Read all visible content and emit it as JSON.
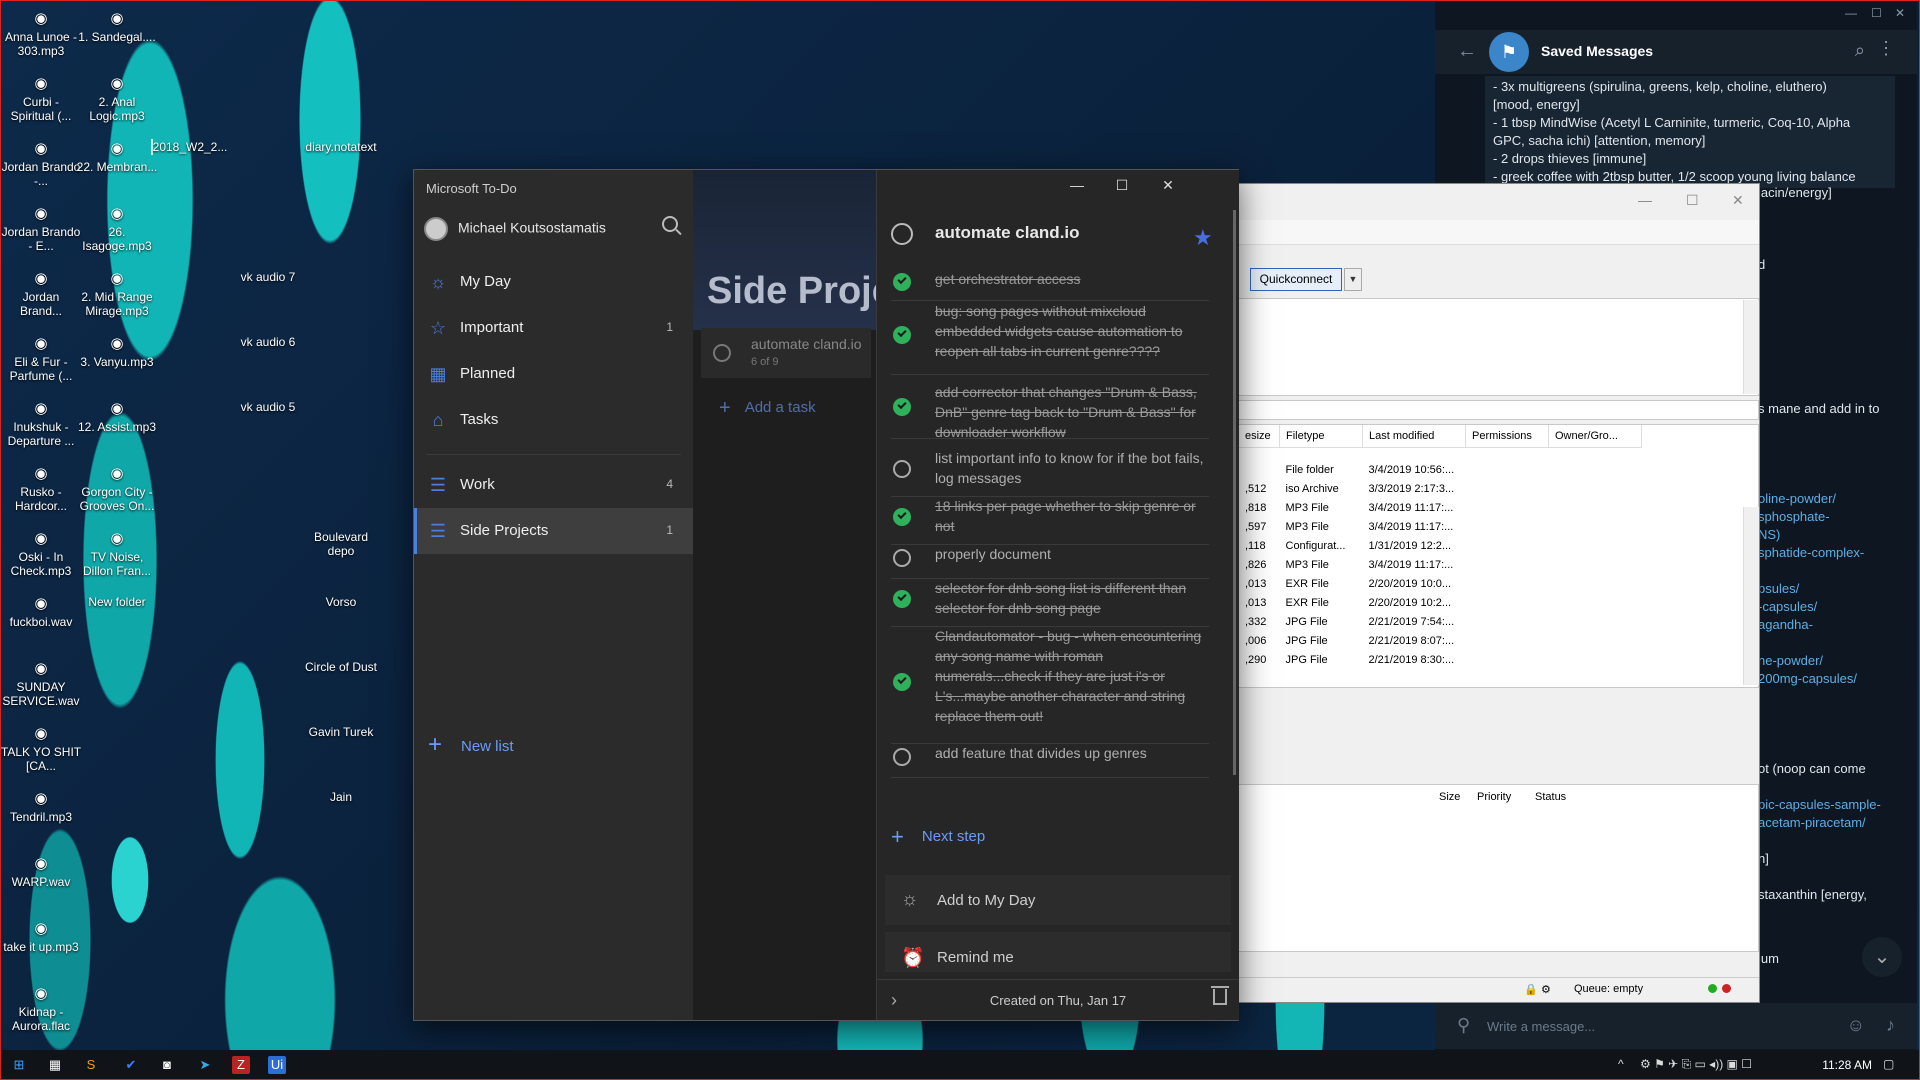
{
  "desktop": {
    "icons": [
      {
        "label": "Anna Lunoe - 303.mp3",
        "type": "audio"
      },
      {
        "label": "1. Sandegal....",
        "type": "audio"
      },
      {
        "label": "Curbi - Spiritual (...",
        "type": "audio"
      },
      {
        "label": "2. Anal Logic.mp3",
        "type": "audio"
      },
      {
        "label": "Jordan Brando -...",
        "type": "audio"
      },
      {
        "label": "22. Membran...",
        "type": "audio"
      },
      {
        "label": "2018_W2_2...",
        "type": "image"
      },
      {
        "label": "diary.notatext",
        "type": "file"
      },
      {
        "label": "Jordan Brando - E...",
        "type": "audio"
      },
      {
        "label": "26. Isagoge.mp3",
        "type": "audio"
      },
      {
        "label": "Jordan Brand...",
        "type": "audio"
      },
      {
        "label": "2. Mid Range Mirage.mp3",
        "type": "audio"
      },
      {
        "label": "vk audio 7",
        "type": "folder"
      },
      {
        "label": "Eli & Fur - Parfume (...",
        "type": "audio"
      },
      {
        "label": "3. Vanyu.mp3",
        "type": "audio"
      },
      {
        "label": "vk audio 6",
        "type": "folder"
      },
      {
        "label": "Inukshuk - Departure ...",
        "type": "audio"
      },
      {
        "label": "12. Assist.mp3",
        "type": "audio"
      },
      {
        "label": "vk audio 5",
        "type": "folder"
      },
      {
        "label": "Rusko - Hardcor...",
        "type": "audio"
      },
      {
        "label": "Gorgon City - Grooves On...",
        "type": "audio"
      },
      {
        "label": "Oski - In Check.mp3",
        "type": "audio"
      },
      {
        "label": "TV Noise, Dillon Fran...",
        "type": "audio"
      },
      {
        "label": "Boulevard depo",
        "type": "folder"
      },
      {
        "label": "fuckboi.wav",
        "type": "audio"
      },
      {
        "label": "New folder",
        "type": "folder"
      },
      {
        "label": "Vorso",
        "type": "folder"
      },
      {
        "label": "SUNDAY SERVICE.wav",
        "type": "audio"
      },
      {
        "label": "Circle of Dust",
        "type": "folder"
      },
      {
        "label": "TALK YO SHIT [CA...",
        "type": "audio"
      },
      {
        "label": "Gavin Turek",
        "type": "folder"
      },
      {
        "label": "Tendril.mp3",
        "type": "audio"
      },
      {
        "label": "Jain",
        "type": "folder"
      },
      {
        "label": "WARP.wav",
        "type": "audio"
      },
      {
        "label": "take it up.mp3",
        "type": "audio"
      },
      {
        "label": "Kidnap - Aurora.flac",
        "type": "audio"
      }
    ]
  },
  "todo": {
    "app_title": "Microsoft To-Do",
    "user_name": "Michael Koutsostamatis",
    "nav": [
      {
        "label": "My Day",
        "count": "",
        "icon": "sun-icon"
      },
      {
        "label": "Important",
        "count": "1",
        "icon": "star-icon"
      },
      {
        "label": "Planned",
        "count": "",
        "icon": "calendar-icon"
      },
      {
        "label": "Tasks",
        "count": "",
        "icon": "home-icon"
      }
    ],
    "lists": [
      {
        "label": "Work",
        "count": "4",
        "icon": "list-icon"
      },
      {
        "label": "Side Projects",
        "count": "1",
        "icon": "list-icon"
      }
    ],
    "new_list": "New list",
    "middle": {
      "title": "Side Proje",
      "task_title": "automate cland.io",
      "task_sub": "6 of 9",
      "add_task": "Add a task"
    },
    "detail": {
      "title": "automate cland.io",
      "steps": [
        {
          "text": "get orchestrator access",
          "done": true
        },
        {
          "text": "bug: song pages without mixcloud embedded widgets cause automation to reopen all tabs in current genre????",
          "done": true
        },
        {
          "text": "add corrector that changes \"Drum & Bass, DnB\" genre tag back to \"Drum & Bass\" for downloader workflow",
          "done": true
        },
        {
          "text": "list important info to know for if the bot fails, log messages",
          "done": false
        },
        {
          "text": "18 links per page whether to skip genre or not",
          "done": true
        },
        {
          "text": "properly document",
          "done": false
        },
        {
          "text": "selector for dnb song list is different than selector for dnb song page",
          "done": true
        },
        {
          "text": "Clandautomator - bug - when encountering any song name with roman numerals...check if they are just i's or L's...maybe another character and string replace them out!",
          "done": true
        },
        {
          "text": "add feature that divides up genres",
          "done": false
        }
      ],
      "next_step": "Next step",
      "add_to_my_day": "Add to My Day",
      "remind_me": "Remind me",
      "created": "Created on Thu, Jan 17"
    }
  },
  "filezilla": {
    "quickconnect": "Quickconnect",
    "columns": [
      "esize",
      "Filetype",
      "Last modified",
      "Permissions",
      "Owner/Gro..."
    ],
    "rows": [
      [
        "",
        "File folder",
        "3/4/2019 10:56:..."
      ],
      [
        ",512",
        "iso Archive",
        "3/3/2019 2:17:3..."
      ],
      [
        ",818",
        "MP3 File",
        "3/4/2019 11:17:..."
      ],
      [
        ",597",
        "MP3 File",
        "3/4/2019 11:17:..."
      ],
      [
        ",118",
        "Configurat...",
        "1/31/2019 12:2..."
      ],
      [
        ",826",
        "MP3 File",
        "3/4/2019 11:17:..."
      ],
      [
        ",013",
        "EXR File",
        "2/20/2019 10:0..."
      ],
      [
        ",013",
        "EXR File",
        "2/20/2019 10:2..."
      ],
      [
        ",332",
        "JPG File",
        "2/21/2019 7:54:..."
      ],
      [
        ",006",
        "JPG File",
        "2/21/2019 8:07:..."
      ],
      [
        ",290",
        "JPG File",
        "2/21/2019 8:30:..."
      ]
    ],
    "queue_columns": [
      "Size",
      "Priority",
      "Status"
    ],
    "queue_status": "Queue: empty"
  },
  "telegram": {
    "title": "Saved Messages",
    "message_lines": [
      "- 3x multigreens (spirulina, greens, kelp, choline, eluthero)",
      "[mood, energy]",
      "- 1 tbsp MindWise (Acetyl L Carninite, turmeric, Coq-10, Alpha",
      "GPC, sacha ichi) [attention, memory]",
      "- 2 drops thieves [immune]",
      "- greek coffee with 2tbsp butter, 1/2 scoop young living balance"
    ],
    "right_fragments": [
      {
        "text": "iacin/energy]",
        "link": false
      },
      {
        "text": "d",
        "link": false
      },
      {
        "text": "s mane and add in to",
        "link": false
      },
      {
        "text": "oline-powder/",
        "link": true
      },
      {
        "text": "sphosphate-",
        "link": true
      },
      {
        "text": "NS)",
        "link": true
      },
      {
        "text": "sphatide-complex-",
        "link": true
      },
      {
        "text": "psules/",
        "link": true
      },
      {
        "text": "-capsules/",
        "link": true
      },
      {
        "text": "agandha-",
        "link": true
      },
      {
        "text": "ne-powder/",
        "link": true
      },
      {
        "text": "200mg-capsules/",
        "link": true
      },
      {
        "text": "ot (noop can come",
        "link": false
      },
      {
        "text": "pic-capsules-sample-",
        "link": true
      },
      {
        "text": "acetam-piracetam/",
        "link": true
      },
      {
        "text": "n]",
        "link": false
      },
      {
        "text": "staxanthin [energy,",
        "link": false
      },
      {
        "text": "ium",
        "link": false
      }
    ],
    "input_placeholder": "Write a message..."
  },
  "taskbar": {
    "time": "11:28 AM"
  },
  "colors": {
    "accent": "#4a7fe0",
    "check_done": "#2eb15a",
    "telegram_bg": "#0e1621"
  }
}
